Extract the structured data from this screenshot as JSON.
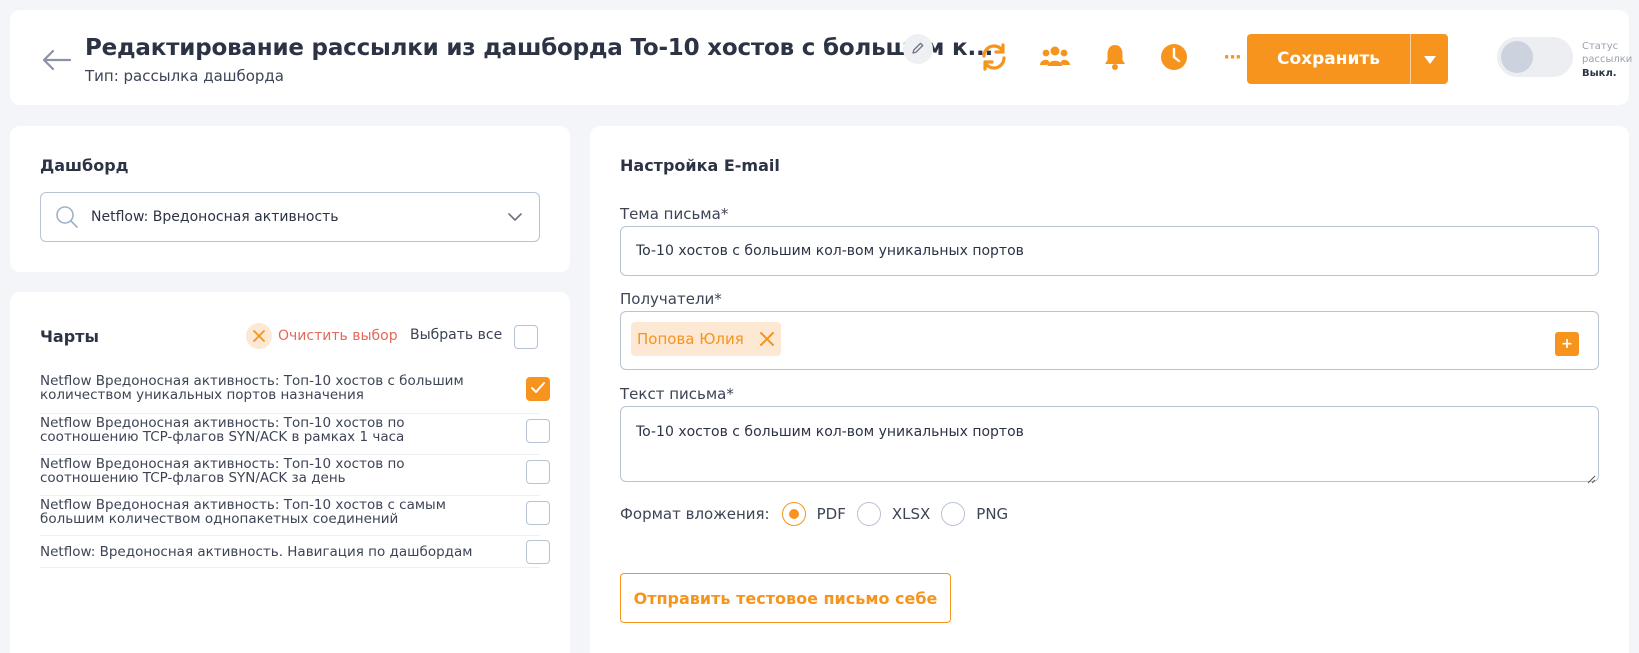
{
  "header": {
    "title": "Редактирование рассылки из дашборда To-10 хостов с большим к...",
    "subtitle": "Тип: рассылка дашборда",
    "more_label": "···",
    "save_label": "Сохранить",
    "status_label": "Статус рассылки",
    "status_value": "Выкл.",
    "status_on": false,
    "icons": [
      "back-arrow-icon",
      "pencil-icon",
      "refresh-icon",
      "users-icon",
      "bell-icon",
      "clock-icon",
      "more-icon",
      "caret-down-icon"
    ],
    "accent": "#f7941d"
  },
  "dashboard": {
    "title": "Дашборд",
    "value": "Netflow: Вредоносная активность"
  },
  "charts": {
    "title": "Чарты",
    "clear_label": "Очистить выбор",
    "select_all_label": "Выбрать все",
    "select_all_checked": false,
    "items": [
      {
        "line1": "Netflow Вредоносная активность: Топ-10 хостов с большим",
        "line2": "количеством уникальных портов назначения",
        "checked": true
      },
      {
        "line1": "Netflow Вредоносная активность: Топ-10 хостов по",
        "line2": "соотношению TCP-флагов SYN/ACK в рамках 1 часа",
        "checked": false
      },
      {
        "line1": "Netflow Вредоносная активность: Топ-10 хостов по",
        "line2": "соотношению TCP-флагов SYN/ACK за день",
        "checked": false
      },
      {
        "line1": "Netflow Вредоносная активность: Топ-10 хостов с самым",
        "line2": "большим количеством однопакетных соединений",
        "checked": false
      },
      {
        "line1": "Netflow: Вредоносная активность. Навигация по дашбордам",
        "line2": "",
        "checked": false
      }
    ]
  },
  "email": {
    "title": "Настройка E-mail",
    "subject_label": "Тема письма*",
    "subject_value": "To-10 хостов с большим кол-вом уникальных портов",
    "recipients_label": "Получатели*",
    "recipients": [
      "Попова Юлия"
    ],
    "add_label": "+",
    "body_label": "Текст письма*",
    "body_value": "To-10 хостов с большим кол-вом уникальных портов",
    "format_label": "Формат вложения:",
    "formats": [
      "PDF",
      "XLSX",
      "PNG"
    ],
    "selected_format": "PDF",
    "test_button_label": "Отправить тестовое письмо себе"
  }
}
